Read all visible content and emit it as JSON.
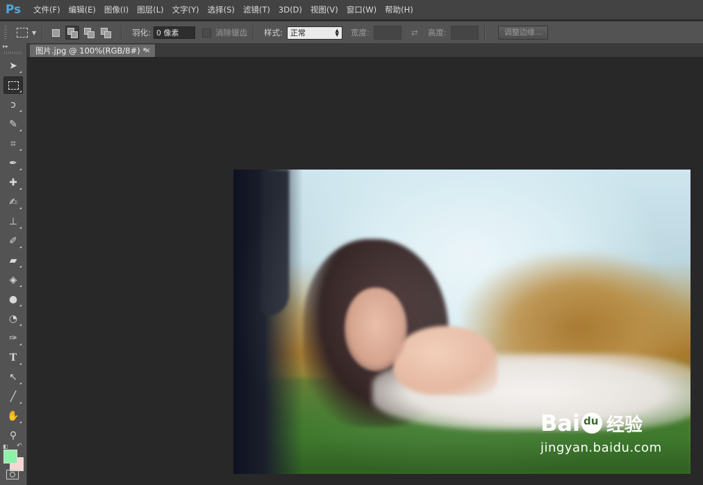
{
  "app": {
    "logo": "Ps"
  },
  "menu": [
    "文件(F)",
    "编辑(E)",
    "图像(I)",
    "图层(L)",
    "文字(Y)",
    "选择(S)",
    "滤镜(T)",
    "3D(D)",
    "视图(V)",
    "窗口(W)",
    "帮助(H)"
  ],
  "options": {
    "feather_label": "羽化:",
    "feather_value": "0 像素",
    "antialias_label": "消除锯齿",
    "style_label": "样式:",
    "style_value": "正常",
    "width_label": "宽度:",
    "height_label": "高度:",
    "refine_edge": "调整边缘..."
  },
  "document": {
    "tab_title": "图片.jpg @ 100%(RGB/8#) *",
    "close": "×"
  },
  "colors": {
    "foreground": "#8ff0a8",
    "background": "#f7d7d2"
  },
  "watermark": {
    "brand_left": "Bai",
    "brand_right": "经验",
    "url": "jingyan.baidu.com"
  }
}
